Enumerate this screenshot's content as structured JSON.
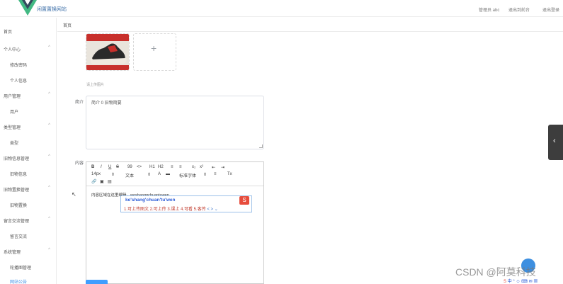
{
  "header": {
    "site_title": "闲置置换网站",
    "admin_label": "管理员 abc",
    "exit_front": "退出到前台",
    "logout": "退出登录"
  },
  "tabs": {
    "home": "首页"
  },
  "sidebar": {
    "items": [
      {
        "label": "首页",
        "type": "top"
      },
      {
        "label": "个人中心",
        "type": "top",
        "arrow": "^"
      },
      {
        "label": "修改密码",
        "type": "sub"
      },
      {
        "label": "个人信息",
        "type": "sub"
      },
      {
        "label": "用户管理",
        "type": "top",
        "arrow": "^"
      },
      {
        "label": "用户",
        "type": "sub"
      },
      {
        "label": "类型管理",
        "type": "top",
        "arrow": "^"
      },
      {
        "label": "类型",
        "type": "sub"
      },
      {
        "label": "旧物信息管理",
        "type": "top",
        "arrow": "^"
      },
      {
        "label": "旧物信息",
        "type": "sub"
      },
      {
        "label": "旧物置换管理",
        "type": "top",
        "arrow": "^"
      },
      {
        "label": "旧物置换",
        "type": "sub"
      },
      {
        "label": "留言交流管理",
        "type": "top",
        "arrow": "^"
      },
      {
        "label": "留言交流",
        "type": "sub"
      },
      {
        "label": "系统管理",
        "type": "top",
        "arrow": "^"
      },
      {
        "label": "轮播图管理",
        "type": "sub"
      },
      {
        "label": "网站公告",
        "type": "sub",
        "active": true
      }
    ]
  },
  "form": {
    "upload_hint": "请上传图片",
    "intro_label": "简介",
    "intro_value": "简介 0 旧物简要",
    "content_label": "内容",
    "editor_text": "内容区域在这里编辑，",
    "editor_underlined": "woshanggchuantuwen"
  },
  "toolbar": {
    "row1": [
      "B",
      "I",
      "U",
      "S",
      "99",
      "<>",
      "H1",
      "H2",
      "≡",
      "≡",
      "x₂",
      "x²",
      "⇤",
      "⇥"
    ],
    "row2": [
      "14px",
      "文本",
      "A",
      "标准字体",
      "≡",
      "Tx"
    ],
    "row3": [
      "🔗",
      "▣",
      "▤"
    ]
  },
  "ime": {
    "composition": "ke'shang'chuan'tu'wen",
    "candidates": "1.可上传图文  2.可上传  3.课上  4.可看  5.客传",
    "nav": "< >  ⌄"
  },
  "watermark": "CSDN @阿莫科技",
  "colors": {
    "accent": "#409eff",
    "vue_green": "#42b983",
    "vue_dark": "#35495e"
  }
}
